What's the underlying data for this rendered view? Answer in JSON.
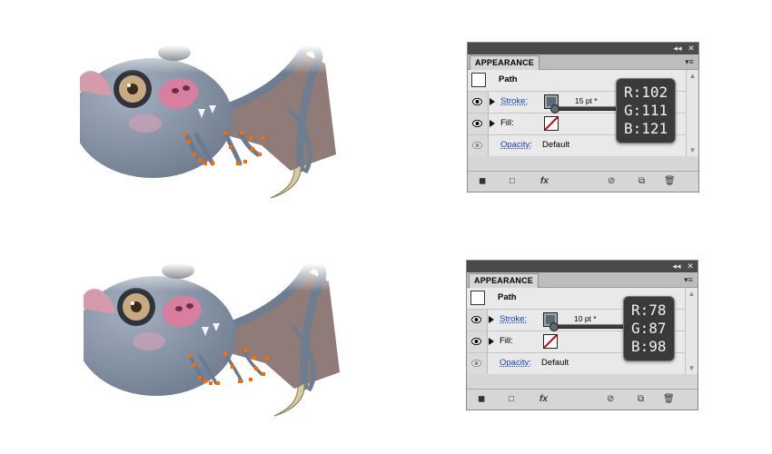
{
  "colors": {
    "bat_body": "#7b889a",
    "wing": "#8f7b78",
    "nose": "#d87fa0",
    "anchor": "#ff6a00",
    "panel_bg": "#d6d6d6",
    "tooltip_bg": "#3a3a3a",
    "link": "#1b3fb8"
  },
  "panels": [
    {
      "tab": "APPEARANCE",
      "title_icons": [
        "collapse-icon",
        "close-icon"
      ],
      "object_label": "Path",
      "stroke_label": "Stroke:",
      "stroke_value": "15 pt *",
      "fill_label": "Fill:",
      "opacity_label": "Opacity:",
      "opacity_value": "Default",
      "tooltip": {
        "r": "R:102",
        "g": "G:111",
        "b": "B:121"
      }
    },
    {
      "tab": "APPEARANCE",
      "title_icons": [
        "collapse-icon",
        "close-icon"
      ],
      "object_label": "Path",
      "stroke_label": "Stroke:",
      "stroke_value": "10 pt *",
      "fill_label": "Fill:",
      "opacity_label": "Opacity:",
      "opacity_value": "Default",
      "tooltip": {
        "r": "R:78",
        "g": "G:87",
        "b": "B:98"
      }
    }
  ],
  "icons": {
    "titlebar": [
      "collapse-icon",
      "close-icon"
    ],
    "rows": [
      "eye-icon",
      "disclosure-triangle-icon",
      "stroke-swatch-icon",
      "fill-none-swatch-icon"
    ],
    "bottom": [
      "add-stroke-icon",
      "add-fill-icon",
      "fx-icon",
      "clear-icon",
      "duplicate-icon",
      "trash-icon"
    ]
  }
}
